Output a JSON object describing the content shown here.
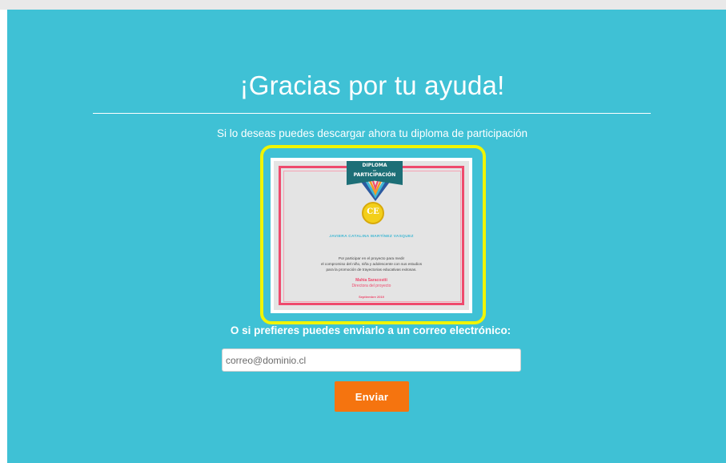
{
  "header": {
    "title": "¡Gracias por tu ayuda!",
    "subtitle": "Si lo deseas puedes descargar ahora tu diploma de participación"
  },
  "diploma": {
    "banner_line1": "DIPLOMA",
    "banner_line2": "DE",
    "banner_line3": "PARTICIPACIÓN",
    "medal_text": "CE",
    "recipient": "JAVIERA CATALINA MARTÍNEZ  VASQUEZ",
    "reason_line1": "Por participar en el proyecto para medir",
    "reason_line2": "el compromiso del niño, niña y adolescente con sus estudios",
    "reason_line3": "para la promoción de trayectorias educativas exitosas.",
    "signer_name": "Mahia Saracostti",
    "signer_role": "Directora del proyecto",
    "date": "Septiembre 2019",
    "highlight_color": "#f0f500"
  },
  "email_form": {
    "prompt": "O si prefieres puedes enviarlo a un correo electrónico:",
    "placeholder": "correo@dominio.cl",
    "value": "",
    "send_label": "Enviar"
  },
  "colors": {
    "panel": "#3fc1d5",
    "button": "#f5740f",
    "accent_pink": "#ef4a6d",
    "banner": "#1d6f77"
  }
}
